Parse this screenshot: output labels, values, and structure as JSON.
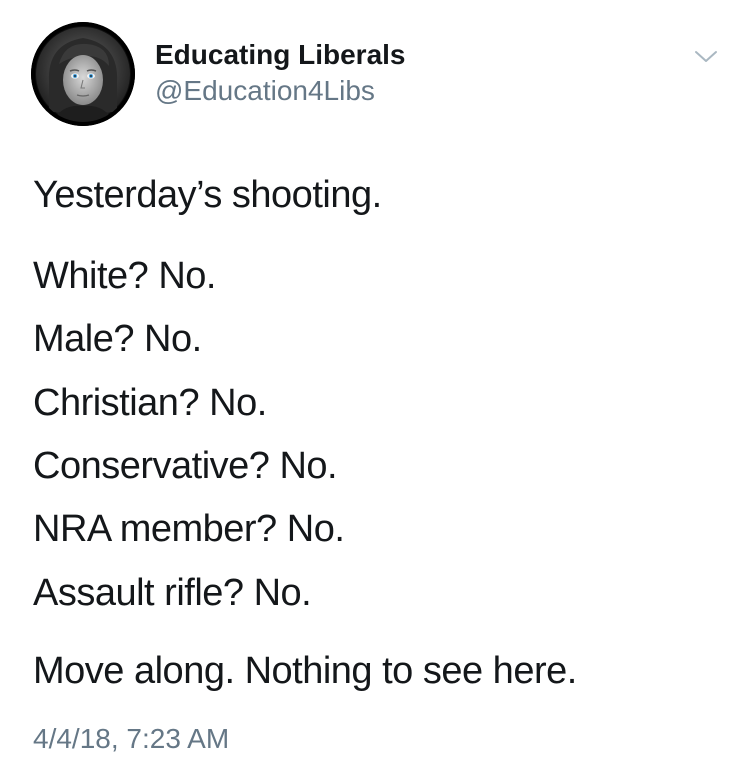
{
  "tweet": {
    "display_name": "Educating Liberals",
    "handle": "@Education4Libs",
    "lines": [
      "Yesterday’s shooting.",
      "White? No.",
      "Male? No.",
      "Christian? No.",
      "Conservative? No.",
      "NRA member? No.",
      "Assault rifle? No.",
      "Move along. Nothing to see here."
    ],
    "timestamp": "4/4/18, 7:23 AM"
  },
  "icons": {
    "menu_caret": "chevron-down-icon",
    "avatar": "profile-photo"
  },
  "colors": {
    "text_primary": "#14171a",
    "text_secondary": "#657786",
    "caret": "#aab8c2"
  }
}
